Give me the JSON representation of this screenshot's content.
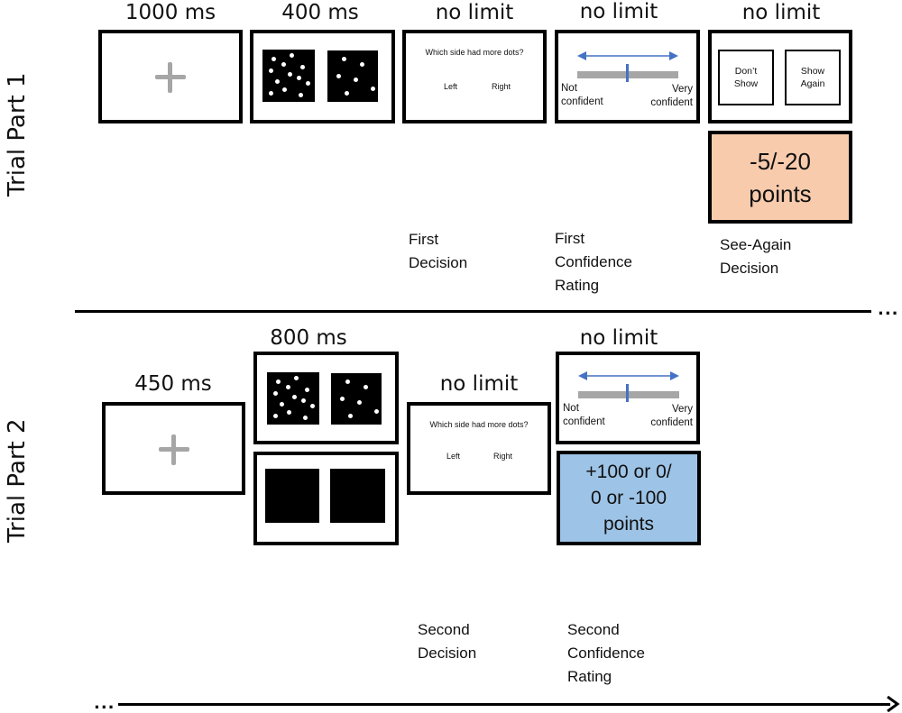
{
  "trial_part_1": {
    "label": "Trial Part 1",
    "stages": [
      {
        "timing": "1000 ms",
        "screen": "fixation-cross"
      },
      {
        "timing": "400 ms",
        "screen": "dot-stimuli"
      },
      {
        "timing": "no limit",
        "screen": "decision",
        "question": "Which side had more dots?",
        "left": "Left",
        "right": "Right",
        "caption": "First Decision"
      },
      {
        "timing": "no limit",
        "screen": "confidence-scale",
        "low_label": "Not confident",
        "high_label": "Very confident",
        "caption": "First Confidence Rating"
      },
      {
        "timing": "no limit",
        "screen": "see-again",
        "option_1": "Don’t Show",
        "option_2": "Show Again",
        "caption": "See-Again Decision",
        "feedback": {
          "text": "-5/-20 points",
          "color": "#f8cbad"
        }
      }
    ],
    "captions": {
      "first_decision_l1": "First",
      "first_decision_l2": "Decision",
      "first_conf_l1": "First",
      "first_conf_l2": "Confidence",
      "first_conf_l3": "Rating",
      "see_again_l1": "See-Again",
      "see_again_l2": "Decision"
    },
    "feedback_l1": "-5/-20",
    "feedback_l2": "points"
  },
  "trial_part_2": {
    "label": "Trial Part 2",
    "stages": [
      {
        "timing": "450 ms",
        "screen": "fixation-cross"
      },
      {
        "timing": "800 ms",
        "screen": "dot-stimuli",
        "alternate": "blank-black-squares"
      },
      {
        "timing": "no limit",
        "screen": "decision",
        "question": "Which side had more dots?",
        "left": "Left",
        "right": "Right",
        "caption": "Second Decision"
      },
      {
        "timing": "no limit",
        "screen": "confidence-scale",
        "low_label": "Not confident",
        "high_label": "Very confident",
        "caption": "Second Confidence Rating",
        "feedback": {
          "text": "+100 or 0/ 0 or -100 points",
          "color": "#9dc3e6"
        }
      }
    ],
    "captions": {
      "second_decision_l1": "Second",
      "second_decision_l2": "Decision",
      "second_conf_l1": "Second",
      "second_conf_l2": "Confidence",
      "second_conf_l3": "Rating"
    },
    "feedback_l1": "+100 or 0/",
    "feedback_l2": "0 or -100",
    "feedback_l3": "points"
  },
  "decision_screen": {
    "question": "Which side had more dots?",
    "left": "Left",
    "right": "Right"
  },
  "confidence_screen": {
    "not_1": "Not",
    "not_2": "confident",
    "very_1": "Very",
    "very_2": "confident"
  },
  "see_again_screen": {
    "dont_1": "Don’t",
    "dont_2": "Show",
    "show_1": "Show",
    "show_2": "Again"
  },
  "continuation": "...",
  "colors": {
    "penalty": "#f8cbad",
    "reward": "#9dc3e6",
    "scale_arrow": "#4472c4",
    "scale_bar": "#a6a6a6",
    "fixation": "#a6a6a6"
  }
}
